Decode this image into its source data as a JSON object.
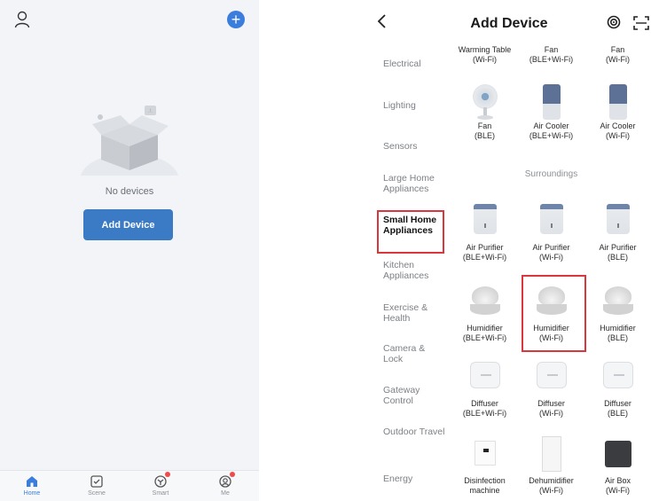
{
  "left": {
    "empty_text": "No devices",
    "add_button": "Add Device",
    "tabs": [
      {
        "label": "Home",
        "icon": "home-icon"
      },
      {
        "label": "Scene",
        "icon": "scene-icon"
      },
      {
        "label": "Smart",
        "icon": "smart-icon"
      },
      {
        "label": "Me",
        "icon": "me-icon"
      }
    ]
  },
  "right": {
    "title": "Add Device",
    "categories": [
      "Electrical",
      "Lighting",
      "Sensors",
      "Large Home Appliances",
      "Small Home Appliances",
      "Kitchen Appliances",
      "Exercise & Health",
      "Camera & Lock",
      "Gateway Control",
      "Outdoor Travel",
      "Energy"
    ],
    "top_devices": [
      {
        "name": "Warming Table",
        "sub": "(Wi-Fi)"
      },
      {
        "name": "Fan",
        "sub": "(BLE+Wi-Fi)"
      },
      {
        "name": "Fan",
        "sub": "(Wi-Fi)"
      }
    ],
    "row2": [
      {
        "name": "Fan",
        "sub": "(BLE)"
      },
      {
        "name": "Air Cooler",
        "sub": "(BLE+Wi-Fi)"
      },
      {
        "name": "Air Cooler",
        "sub": "(Wi-Fi)"
      }
    ],
    "section": "Surroundings",
    "row3": [
      {
        "name": "Air Purifier",
        "sub": "(BLE+Wi-Fi)"
      },
      {
        "name": "Air Purifier",
        "sub": "(Wi-Fi)"
      },
      {
        "name": "Air Purifier",
        "sub": "(BLE)"
      }
    ],
    "row4": [
      {
        "name": "Humidifier",
        "sub": "(BLE+Wi-Fi)"
      },
      {
        "name": "Humidifier",
        "sub": "(Wi-Fi)"
      },
      {
        "name": "Humidifier",
        "sub": "(BLE)"
      }
    ],
    "row5": [
      {
        "name": "Diffuser",
        "sub": "(BLE+Wi-Fi)"
      },
      {
        "name": "Diffuser",
        "sub": "(Wi-Fi)"
      },
      {
        "name": "Diffuser",
        "sub": "(BLE)"
      }
    ],
    "row6": [
      {
        "name": "Disinfection",
        "sub": "machine"
      },
      {
        "name": "Dehumidifier",
        "sub": "(Wi-Fi)"
      },
      {
        "name": "Air Box",
        "sub": "(Wi-Fi)"
      }
    ]
  },
  "colors": {
    "accent": "#3b7ddd",
    "highlight": "#d9363e"
  }
}
